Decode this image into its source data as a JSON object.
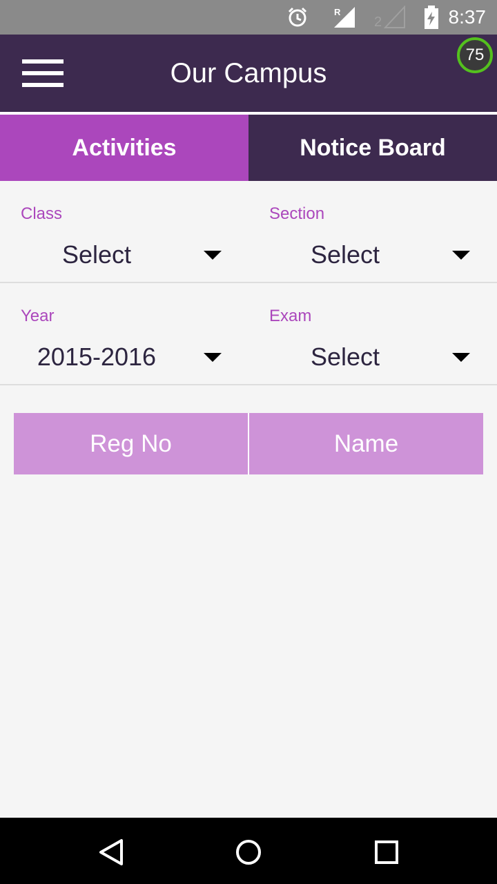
{
  "status_bar": {
    "time": "8:37",
    "icons": [
      "alarm-icon",
      "signal-r-icon",
      "signal-2-icon",
      "battery-charging-icon"
    ]
  },
  "app_bar": {
    "title": "Our Campus",
    "badge": "75",
    "menu_icon": "hamburger-menu-icon"
  },
  "tabs": [
    {
      "label": "Activities",
      "active": true
    },
    {
      "label": "Notice Board",
      "active": false
    }
  ],
  "filters": {
    "class": {
      "label": "Class",
      "value": "Select"
    },
    "section": {
      "label": "Section",
      "value": "Select"
    },
    "year": {
      "label": "Year",
      "value": "2015-2016"
    },
    "exam": {
      "label": "Exam",
      "value": "Select"
    }
  },
  "table": {
    "columns": [
      "Reg No",
      "Name"
    ]
  },
  "nav_bar": {
    "icons": [
      "back-icon",
      "home-icon",
      "recents-icon"
    ]
  },
  "colors": {
    "primary_dark": "#3d2a4f",
    "accent": "#ab47bc",
    "table_header": "#ce93d8",
    "status_bar": "#8a8a8a"
  }
}
